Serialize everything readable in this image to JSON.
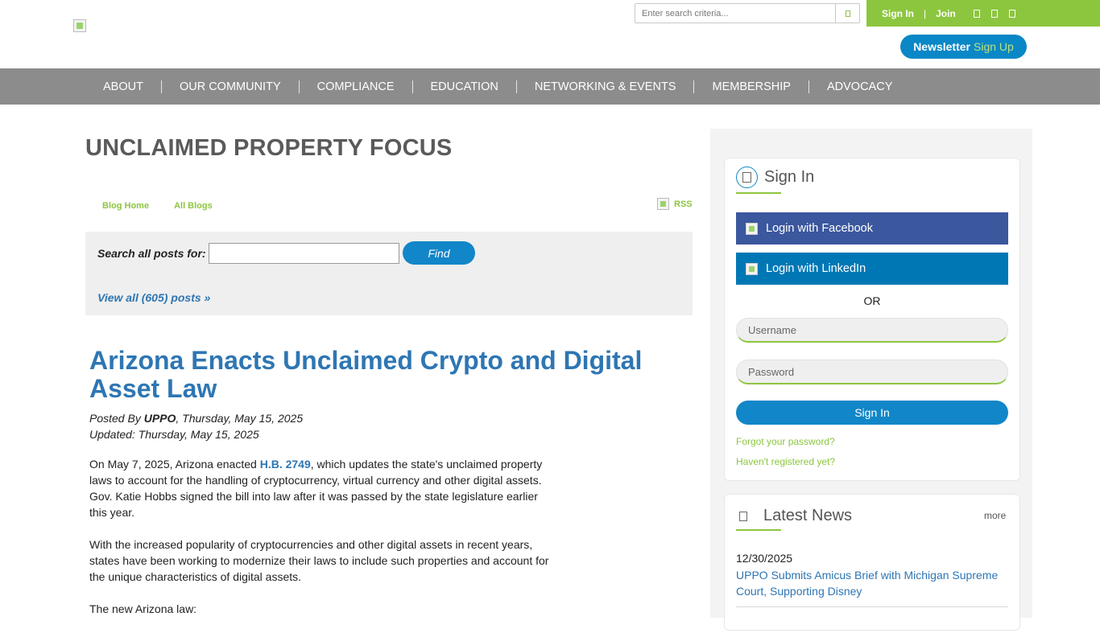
{
  "header": {
    "search_placeholder": "Enter search criteria...",
    "sign_in": "Sign In",
    "separator": "|",
    "join": "Join",
    "newsletter_label": "Newsletter",
    "newsletter_signup": "Sign Up"
  },
  "nav": {
    "items": [
      "ABOUT",
      "OUR COMMUNITY",
      "COMPLIANCE",
      "EDUCATION",
      "NETWORKING & EVENTS",
      "MEMBERSHIP",
      "ADVOCACY"
    ]
  },
  "main": {
    "page_title": "UNCLAIMED PROPERTY FOCUS",
    "blog_home": "Blog Home",
    "all_blogs": "All Blogs",
    "rss": "RSS",
    "search_label": "Search all posts for:",
    "find_button": "Find",
    "view_all": "View all (605) posts »",
    "post": {
      "title": "Arizona Enacts Unclaimed Crypto and Digital Asset Law",
      "posted_by_prefix": "Posted By ",
      "author": "UPPO",
      "posted_date": ", Thursday, May 15, 2025",
      "updated": "Updated: Thursday, May 15, 2025",
      "p1_before": "On May 7, 2025, Arizona enacted ",
      "p1_link": "H.B. 2749",
      "p1_after": ", which updates the state's unclaimed property laws to account for the handling of cryptocurrency, virtual currency and other digital assets. Gov. Katie Hobbs signed the bill into law after it was passed by the state legislature earlier this year.",
      "p2": "With the increased popularity of cryptocurrencies and other digital assets in recent years, states have been working to modernize their laws to include such properties and account for the unique characteristics of digital assets.",
      "p3": "The new Arizona law:"
    }
  },
  "sidebar": {
    "signin": {
      "title": "Sign In",
      "facebook": "Login with Facebook",
      "linkedin": "Login with LinkedIn",
      "or": "OR",
      "username_placeholder": "Username",
      "password_placeholder": "Password",
      "button": "Sign In",
      "forgot": "Forgot your password?",
      "register": "Haven't registered yet?"
    },
    "news": {
      "title": "Latest News",
      "more": "more",
      "items": [
        {
          "date": "12/30/2025",
          "title": "UPPO Submits Amicus Brief with Michigan Supreme Court, Supporting Disney"
        }
      ]
    }
  },
  "colors": {
    "brand_green": "#8cc63f",
    "brand_blue": "#1186c8",
    "nav_gray": "#8c8c8c",
    "link_blue": "#2e76b3",
    "facebook": "#3b579d",
    "linkedin": "#0077b5"
  }
}
